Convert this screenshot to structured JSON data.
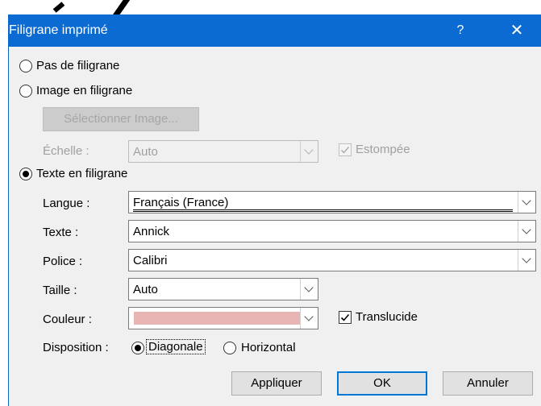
{
  "window": {
    "title": "Filigrane imprimé",
    "help": "?",
    "close": "✕"
  },
  "options": {
    "none": "Pas de filigrane",
    "image": "Image en filigrane",
    "select_image_button": "Sélectionner Image...",
    "scale_label": "Échelle :",
    "scale_value": "Auto",
    "washout_label": "Estompée",
    "text": "Texte en filigrane",
    "selected": "text"
  },
  "text_settings": {
    "language_label": "Langue :",
    "language_value": "Français (France)",
    "text_label": "Texte :",
    "text_value": "Annick",
    "font_label": "Police :",
    "font_value": "Calibri",
    "size_label": "Taille :",
    "size_value": "Auto",
    "color_label": "Couleur :",
    "color_value": "#e8b4b4",
    "translucent_label": "Translucide",
    "translucent_checked": true,
    "layout_label": "Disposition :",
    "layout_diagonal": "Diagonale",
    "layout_horizontal": "Horizontal",
    "layout_selected": "diagonal"
  },
  "buttons": {
    "apply": "Appliquer",
    "ok": "OK",
    "cancel": "Annuler"
  }
}
